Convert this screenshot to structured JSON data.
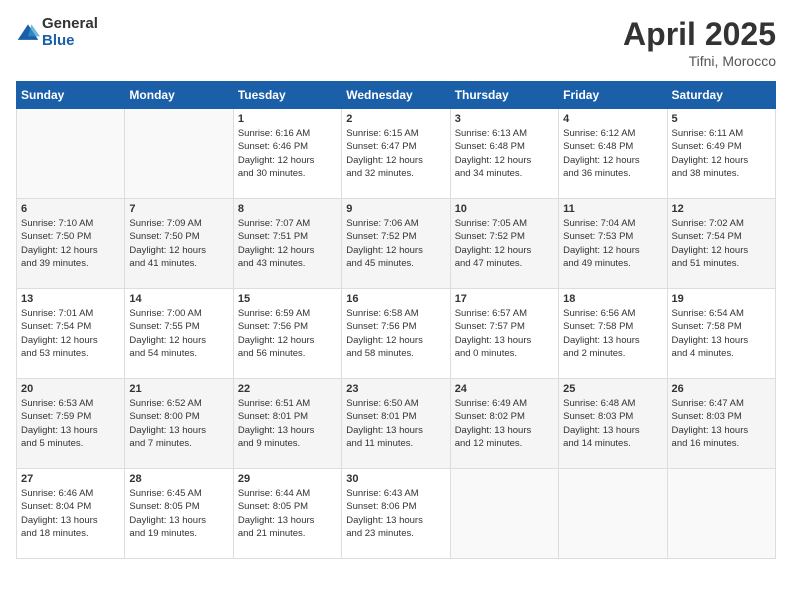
{
  "header": {
    "logo_general": "General",
    "logo_blue": "Blue",
    "month": "April 2025",
    "location": "Tifni, Morocco"
  },
  "weekdays": [
    "Sunday",
    "Monday",
    "Tuesday",
    "Wednesday",
    "Thursday",
    "Friday",
    "Saturday"
  ],
  "weeks": [
    [
      {
        "day": "",
        "detail": ""
      },
      {
        "day": "",
        "detail": ""
      },
      {
        "day": "1",
        "detail": "Sunrise: 6:16 AM\nSunset: 6:46 PM\nDaylight: 12 hours\nand 30 minutes."
      },
      {
        "day": "2",
        "detail": "Sunrise: 6:15 AM\nSunset: 6:47 PM\nDaylight: 12 hours\nand 32 minutes."
      },
      {
        "day": "3",
        "detail": "Sunrise: 6:13 AM\nSunset: 6:48 PM\nDaylight: 12 hours\nand 34 minutes."
      },
      {
        "day": "4",
        "detail": "Sunrise: 6:12 AM\nSunset: 6:48 PM\nDaylight: 12 hours\nand 36 minutes."
      },
      {
        "day": "5",
        "detail": "Sunrise: 6:11 AM\nSunset: 6:49 PM\nDaylight: 12 hours\nand 38 minutes."
      }
    ],
    [
      {
        "day": "6",
        "detail": "Sunrise: 7:10 AM\nSunset: 7:50 PM\nDaylight: 12 hours\nand 39 minutes."
      },
      {
        "day": "7",
        "detail": "Sunrise: 7:09 AM\nSunset: 7:50 PM\nDaylight: 12 hours\nand 41 minutes."
      },
      {
        "day": "8",
        "detail": "Sunrise: 7:07 AM\nSunset: 7:51 PM\nDaylight: 12 hours\nand 43 minutes."
      },
      {
        "day": "9",
        "detail": "Sunrise: 7:06 AM\nSunset: 7:52 PM\nDaylight: 12 hours\nand 45 minutes."
      },
      {
        "day": "10",
        "detail": "Sunrise: 7:05 AM\nSunset: 7:52 PM\nDaylight: 12 hours\nand 47 minutes."
      },
      {
        "day": "11",
        "detail": "Sunrise: 7:04 AM\nSunset: 7:53 PM\nDaylight: 12 hours\nand 49 minutes."
      },
      {
        "day": "12",
        "detail": "Sunrise: 7:02 AM\nSunset: 7:54 PM\nDaylight: 12 hours\nand 51 minutes."
      }
    ],
    [
      {
        "day": "13",
        "detail": "Sunrise: 7:01 AM\nSunset: 7:54 PM\nDaylight: 12 hours\nand 53 minutes."
      },
      {
        "day": "14",
        "detail": "Sunrise: 7:00 AM\nSunset: 7:55 PM\nDaylight: 12 hours\nand 54 minutes."
      },
      {
        "day": "15",
        "detail": "Sunrise: 6:59 AM\nSunset: 7:56 PM\nDaylight: 12 hours\nand 56 minutes."
      },
      {
        "day": "16",
        "detail": "Sunrise: 6:58 AM\nSunset: 7:56 PM\nDaylight: 12 hours\nand 58 minutes."
      },
      {
        "day": "17",
        "detail": "Sunrise: 6:57 AM\nSunset: 7:57 PM\nDaylight: 13 hours\nand 0 minutes."
      },
      {
        "day": "18",
        "detail": "Sunrise: 6:56 AM\nSunset: 7:58 PM\nDaylight: 13 hours\nand 2 minutes."
      },
      {
        "day": "19",
        "detail": "Sunrise: 6:54 AM\nSunset: 7:58 PM\nDaylight: 13 hours\nand 4 minutes."
      }
    ],
    [
      {
        "day": "20",
        "detail": "Sunrise: 6:53 AM\nSunset: 7:59 PM\nDaylight: 13 hours\nand 5 minutes."
      },
      {
        "day": "21",
        "detail": "Sunrise: 6:52 AM\nSunset: 8:00 PM\nDaylight: 13 hours\nand 7 minutes."
      },
      {
        "day": "22",
        "detail": "Sunrise: 6:51 AM\nSunset: 8:01 PM\nDaylight: 13 hours\nand 9 minutes."
      },
      {
        "day": "23",
        "detail": "Sunrise: 6:50 AM\nSunset: 8:01 PM\nDaylight: 13 hours\nand 11 minutes."
      },
      {
        "day": "24",
        "detail": "Sunrise: 6:49 AM\nSunset: 8:02 PM\nDaylight: 13 hours\nand 12 minutes."
      },
      {
        "day": "25",
        "detail": "Sunrise: 6:48 AM\nSunset: 8:03 PM\nDaylight: 13 hours\nand 14 minutes."
      },
      {
        "day": "26",
        "detail": "Sunrise: 6:47 AM\nSunset: 8:03 PM\nDaylight: 13 hours\nand 16 minutes."
      }
    ],
    [
      {
        "day": "27",
        "detail": "Sunrise: 6:46 AM\nSunset: 8:04 PM\nDaylight: 13 hours\nand 18 minutes."
      },
      {
        "day": "28",
        "detail": "Sunrise: 6:45 AM\nSunset: 8:05 PM\nDaylight: 13 hours\nand 19 minutes."
      },
      {
        "day": "29",
        "detail": "Sunrise: 6:44 AM\nSunset: 8:05 PM\nDaylight: 13 hours\nand 21 minutes."
      },
      {
        "day": "30",
        "detail": "Sunrise: 6:43 AM\nSunset: 8:06 PM\nDaylight: 13 hours\nand 23 minutes."
      },
      {
        "day": "",
        "detail": ""
      },
      {
        "day": "",
        "detail": ""
      },
      {
        "day": "",
        "detail": ""
      }
    ]
  ]
}
